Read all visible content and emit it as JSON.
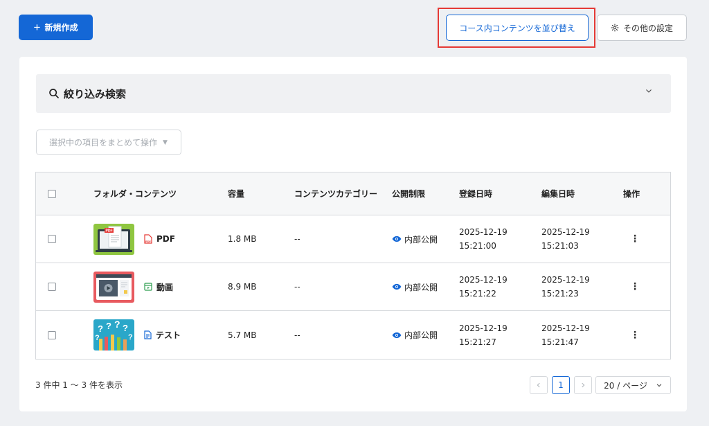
{
  "toolbar": {
    "new_label": "新規作成",
    "reorder_label": "コース内コンテンツを並び替え",
    "settings_label": "その他の設定"
  },
  "filter": {
    "title": "絞り込み検索"
  },
  "bulk": {
    "label": "選択中の項目をまとめて操作"
  },
  "table": {
    "headers": {
      "name": "フォルダ・コンテンツ",
      "size": "容量",
      "category": "コンテンツカテゴリー",
      "visibility": "公開制限",
      "registered": "登録日時",
      "edited": "編集日時",
      "action": "操作"
    },
    "rows": [
      {
        "type": "pdf",
        "name": "PDF",
        "size": "1.8 MB",
        "category": "--",
        "visibility": "内部公開",
        "reg_date": "2025-12-19",
        "reg_time": "15:21:00",
        "edit_date": "2025-12-19",
        "edit_time": "15:21:03"
      },
      {
        "type": "video",
        "name": "動画",
        "size": "8.9 MB",
        "category": "--",
        "visibility": "内部公開",
        "reg_date": "2025-12-19",
        "reg_time": "15:21:22",
        "edit_date": "2025-12-19",
        "edit_time": "15:21:23"
      },
      {
        "type": "test",
        "name": "テスト",
        "size": "5.7 MB",
        "category": "--",
        "visibility": "内部公開",
        "reg_date": "2025-12-19",
        "reg_time": "15:21:27",
        "edit_date": "2025-12-19",
        "edit_time": "15:21:47"
      }
    ]
  },
  "footer": {
    "count_text": "3 件中 1 ～ 3 件を表示",
    "current_page": "1",
    "page_size": "20 / ページ"
  },
  "colors": {
    "primary": "#1467d6",
    "highlight": "#e53935",
    "pdf_icon": "#e53935",
    "video_icon": "#2e9e4f",
    "test_icon": "#1467d6"
  },
  "icons": [
    "plus-icon",
    "gear-icon",
    "search-icon",
    "chevron-down-icon",
    "pdf-file-icon",
    "video-file-icon",
    "test-file-icon",
    "eye-icon",
    "kebab-icon"
  ]
}
